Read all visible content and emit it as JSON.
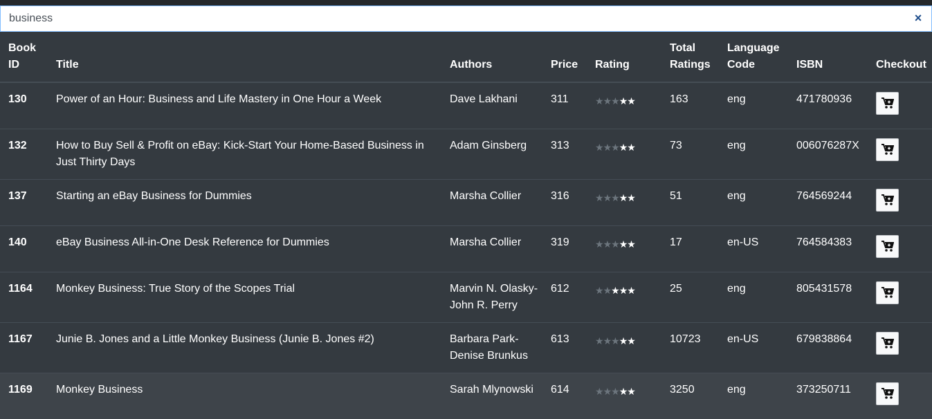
{
  "search": {
    "value": "business",
    "clear_icon": "×"
  },
  "table": {
    "headers": [
      "Book ID",
      "Title",
      "Authors",
      "Price",
      "Rating",
      "Total Ratings",
      "Language Code",
      "ISBN",
      "Checkout"
    ],
    "rows": [
      {
        "id": "130",
        "title": "Power of an Hour: Business and Life Mastery in One Hour a Week",
        "authors": "Dave Lakhani",
        "price": "311",
        "rating": 3.5,
        "total": "163",
        "lang": "eng",
        "isbn": "471780936"
      },
      {
        "id": "132",
        "title": "How to Buy Sell & Profit on eBay: Kick-Start Your Home-Based Business in Just Thirty Days",
        "authors": "Adam Ginsberg",
        "price": "313",
        "rating": 3.5,
        "total": "73",
        "lang": "eng",
        "isbn": "006076287X"
      },
      {
        "id": "137",
        "title": "Starting an eBay Business for Dummies",
        "authors": "Marsha Collier",
        "price": "316",
        "rating": 3.5,
        "total": "51",
        "lang": "eng",
        "isbn": "764569244"
      },
      {
        "id": "140",
        "title": "eBay Business All-in-One Desk Reference for Dummies",
        "authors": "Marsha Collier",
        "price": "319",
        "rating": 4,
        "total": "17",
        "lang": "en-US",
        "isbn": "764584383"
      },
      {
        "id": "1164",
        "title": "Monkey Business: True Story of the Scopes Trial",
        "authors": "Marvin N. Olasky-John R. Perry",
        "price": "612",
        "rating": 3,
        "total": "25",
        "lang": "eng",
        "isbn": "805431578"
      },
      {
        "id": "1167",
        "title": "Junie B. Jones and a Little Monkey Business (Junie B. Jones #2)",
        "authors": "Barbara Park-Denise Brunkus",
        "price": "613",
        "rating": 4,
        "total": "10723",
        "lang": "en-US",
        "isbn": "679838864"
      },
      {
        "id": "1169",
        "title": "Monkey Business",
        "authors": "Sarah Mlynowski",
        "price": "614",
        "rating": 3.5,
        "total": "3250",
        "lang": "eng",
        "isbn": "373250711"
      }
    ],
    "hovered_row_index": 6,
    "checkout_icon": "cart-plus-icon"
  }
}
